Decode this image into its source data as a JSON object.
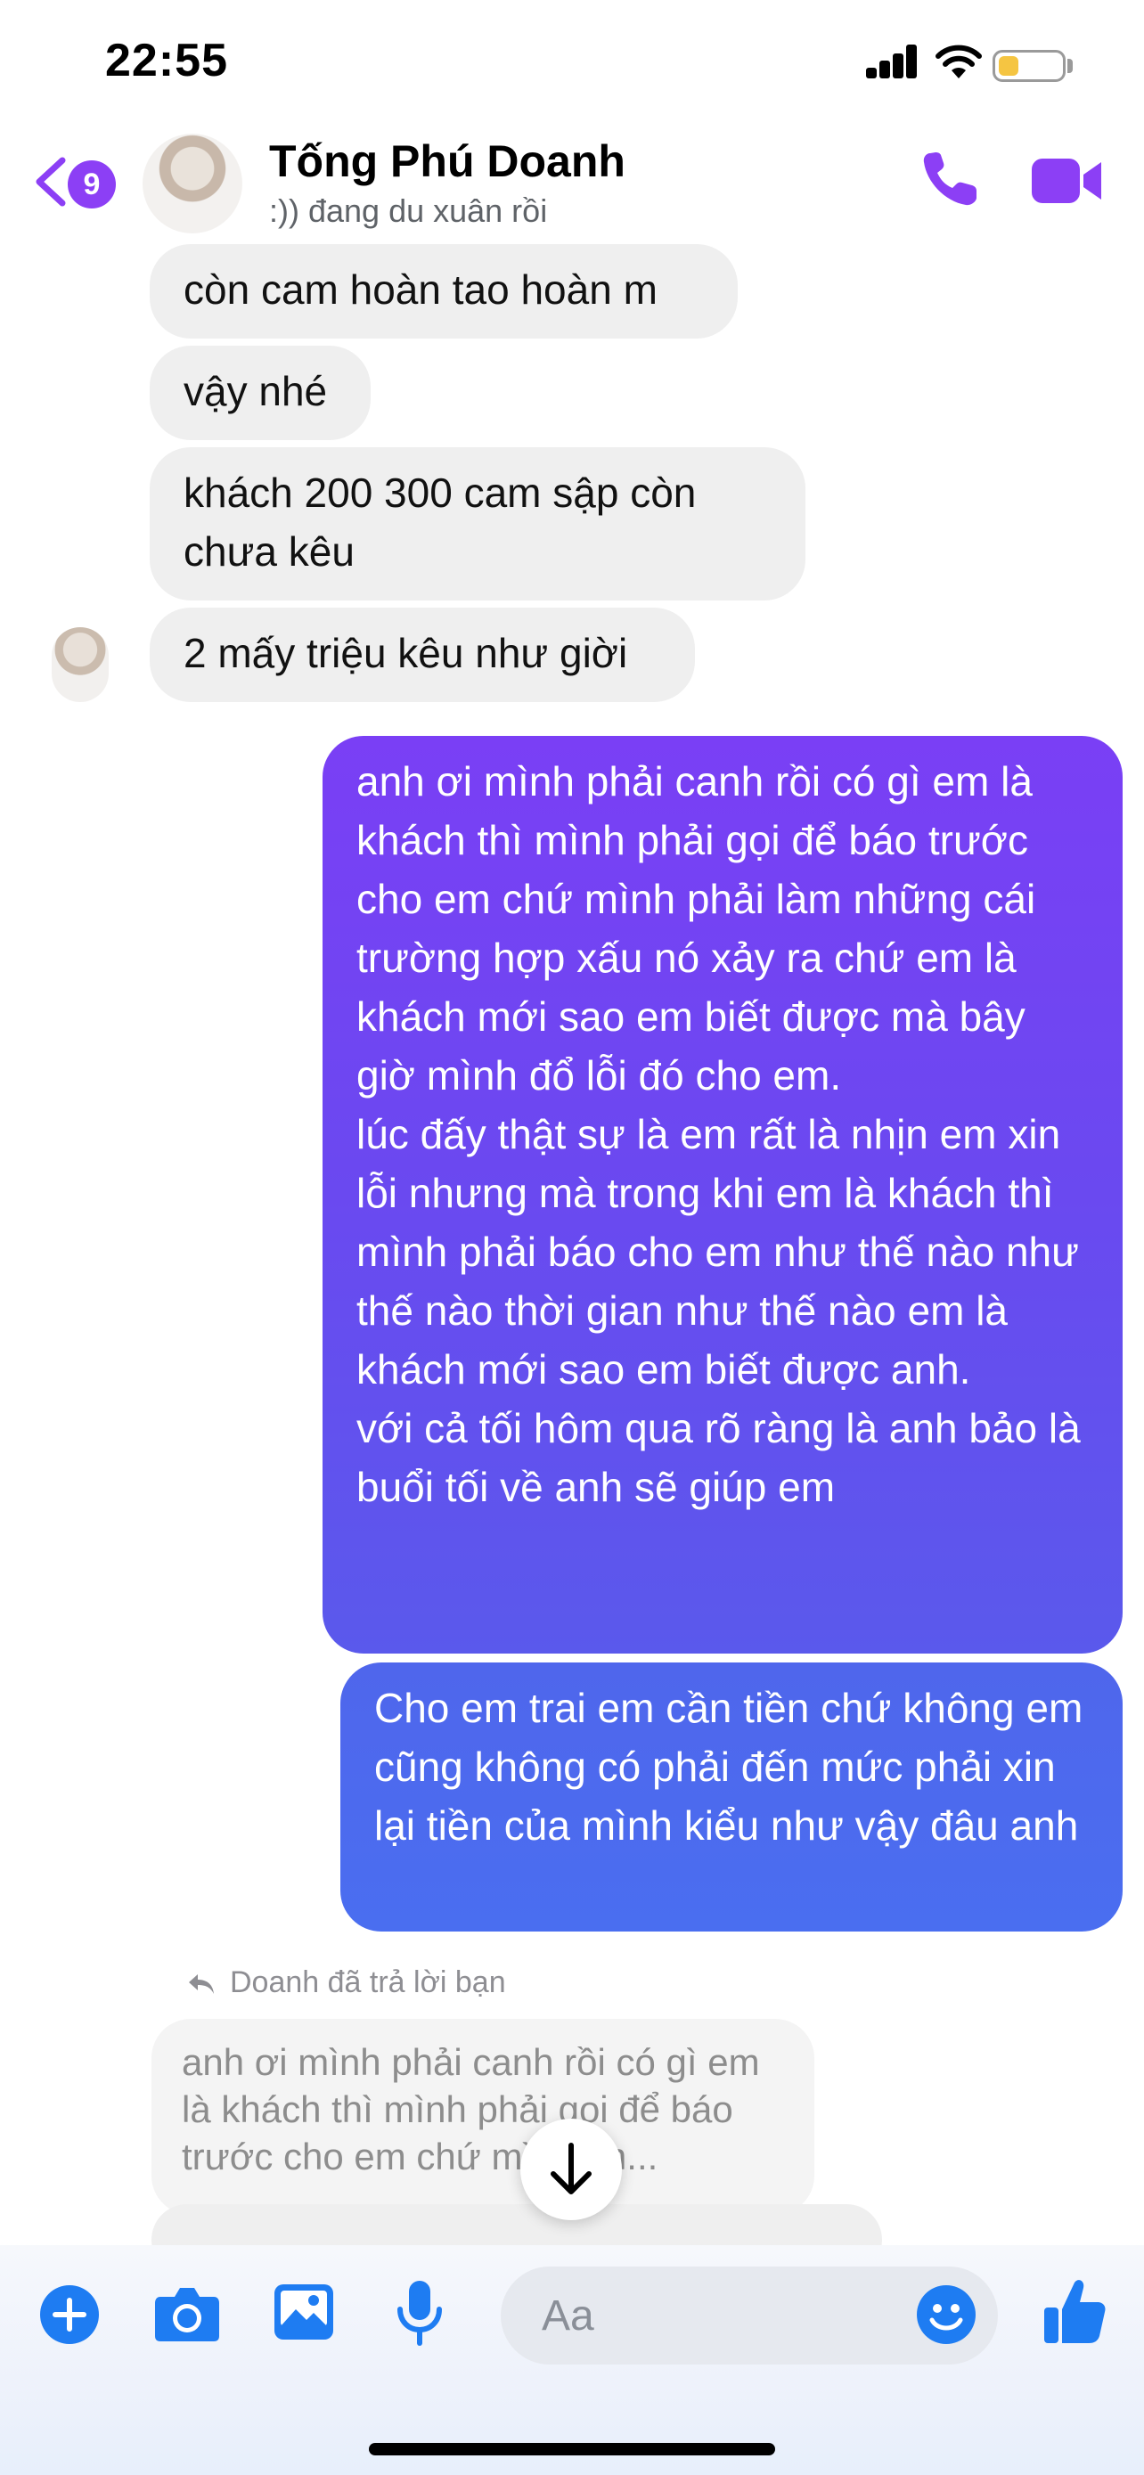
{
  "status_bar": {
    "time": "22:55",
    "battery_color": "#f5c542"
  },
  "header": {
    "back_badge_count": "9",
    "contact_name": "Tống Phú Doanh",
    "contact_status": ":)) đang du xuân rồi",
    "accent": "#8c3ff5",
    "icons": [
      "chevron-left-icon",
      "phone-icon",
      "video-camera-icon"
    ]
  },
  "messages": {
    "incoming": [
      "còn cam hoàn tao hoàn m",
      "vậy nhé",
      "khách 200 300 cam sập còn chưa kêu",
      "2 mấy triệu kêu như giời"
    ],
    "outgoing_1": "anh ơi mình phải canh rồi có gì em là khách thì mình phải gọi để báo trước cho em chứ mình phải làm những cái trường hợp xấu nó xảy ra chứ em là khách mới sao em biết được mà bây giờ mình đổ lỗi đó cho em.\nlúc đấy thật sự là em rất là nhịn em xin lỗi nhưng mà trong khi em là khách thì mình phải báo cho em như thế nào như thế nào thời gian như thế nào em là khách mới sao em biết được anh.\nvới cả tối hôm qua rõ ràng là anh bảo là buổi tối về anh sẽ giúp em",
    "outgoing_2": "Cho em trai em cần tiền chứ không em cũng không có phải đến mức phải xin lại tiền của mình kiểu như vậy đâu anh",
    "reply_label": "Doanh đã trả lời bạn",
    "reply_quote": "anh ơi mình phải canh rồi có gì em là khách thì mình phải gọi để báo trước cho em chứ mình ph..."
  },
  "composer": {
    "placeholder": "Aa",
    "icons": [
      "plus-icon",
      "camera-icon",
      "image-icon",
      "microphone-icon",
      "emoji-icon",
      "thumbs-up-icon"
    ],
    "accent": "#1e7cf2"
  }
}
